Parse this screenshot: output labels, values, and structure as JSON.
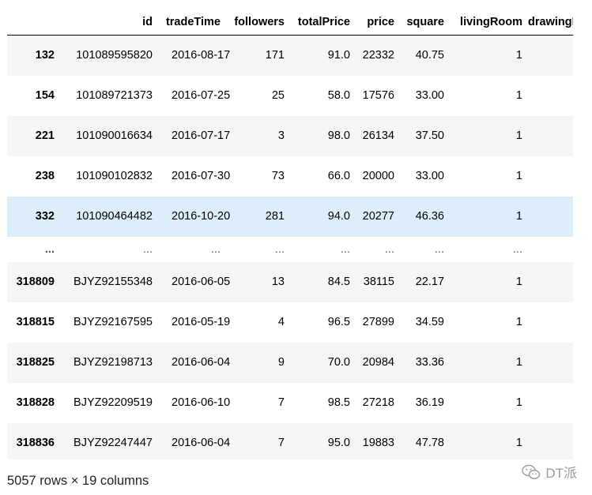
{
  "table": {
    "columns": [
      "",
      "id",
      "tradeTime",
      "followers",
      "totalPrice",
      "price",
      "square",
      "livingRoom",
      "drawingRoom"
    ],
    "rows": [
      {
        "index": "132",
        "id": "101089595820",
        "tradeTime": "2016-08-17",
        "followers": "171",
        "totalPrice": "91.0",
        "price": "22332",
        "square": "40.75",
        "livingRoom": "1"
      },
      {
        "index": "154",
        "id": "101089721373",
        "tradeTime": "2016-07-25",
        "followers": "25",
        "totalPrice": "58.0",
        "price": "17576",
        "square": "33.00",
        "livingRoom": "1"
      },
      {
        "index": "221",
        "id": "101090016634",
        "tradeTime": "2016-07-17",
        "followers": "3",
        "totalPrice": "98.0",
        "price": "26134",
        "square": "37.50",
        "livingRoom": "1"
      },
      {
        "index": "238",
        "id": "101090102832",
        "tradeTime": "2016-07-30",
        "followers": "73",
        "totalPrice": "66.0",
        "price": "20000",
        "square": "33.00",
        "livingRoom": "1"
      },
      {
        "index": "332",
        "id": "101090464482",
        "tradeTime": "2016-10-20",
        "followers": "281",
        "totalPrice": "94.0",
        "price": "20277",
        "square": "46.36",
        "livingRoom": "1"
      },
      {
        "index": "...",
        "id": "...",
        "tradeTime": "...",
        "followers": "...",
        "totalPrice": "...",
        "price": "...",
        "square": "...",
        "livingRoom": "..."
      },
      {
        "index": "318809",
        "id": "BJYZ92155348",
        "tradeTime": "2016-06-05",
        "followers": "13",
        "totalPrice": "84.5",
        "price": "38115",
        "square": "22.17",
        "livingRoom": "1"
      },
      {
        "index": "318815",
        "id": "BJYZ92167595",
        "tradeTime": "2016-05-19",
        "followers": "4",
        "totalPrice": "96.5",
        "price": "27899",
        "square": "34.59",
        "livingRoom": "1"
      },
      {
        "index": "318825",
        "id": "BJYZ92198713",
        "tradeTime": "2016-06-04",
        "followers": "9",
        "totalPrice": "70.0",
        "price": "20984",
        "square": "33.36",
        "livingRoom": "1"
      },
      {
        "index": "318828",
        "id": "BJYZ92209519",
        "tradeTime": "2016-06-10",
        "followers": "7",
        "totalPrice": "98.5",
        "price": "27218",
        "square": "36.19",
        "livingRoom": "1"
      },
      {
        "index": "318836",
        "id": "BJYZ92247447",
        "tradeTime": "2016-06-04",
        "followers": "7",
        "totalPrice": "95.0",
        "price": "19883",
        "square": "47.78",
        "livingRoom": "1"
      }
    ],
    "highlighted_row": "332",
    "footer": "5057 rows × 19 columns"
  },
  "watermark": {
    "text": "DT派",
    "icon": "wechat-icon"
  },
  "colors": {
    "row_odd": "#f5f5f5",
    "row_even": "#ffffff",
    "row_hover": "#ddeefb"
  }
}
